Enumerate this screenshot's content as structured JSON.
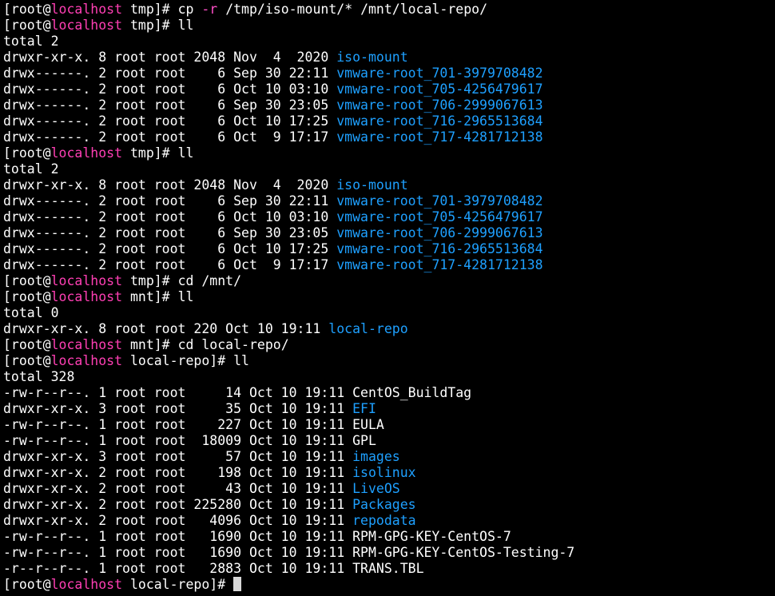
{
  "colors": {
    "background": "#000000",
    "text": "#ffffff",
    "hostname": "#ff3fb4",
    "directory": "#1ea0ff",
    "cursor": "#d8d8d8"
  },
  "terminal": {
    "lines": [
      {
        "kind": "prompt",
        "user": "root",
        "host": "localhost",
        "cwd": "tmp",
        "cmd": "cp -r /tmp/iso-mount/* /mnt/local-repo/"
      },
      {
        "kind": "prompt",
        "user": "root",
        "host": "localhost",
        "cwd": "tmp",
        "cmd": "ll"
      },
      {
        "kind": "text",
        "text": "total 2"
      },
      {
        "kind": "entry",
        "meta": "drwxr-xr-x. 8 root root 2048 Nov  4  2020 ",
        "name": "iso-mount",
        "dir": true
      },
      {
        "kind": "entry",
        "meta": "drwx------. 2 root root    6 Sep 30 22:11 ",
        "name": "vmware-root_701-3979708482",
        "dir": true
      },
      {
        "kind": "entry",
        "meta": "drwx------. 2 root root    6 Oct 10 03:10 ",
        "name": "vmware-root_705-4256479617",
        "dir": true
      },
      {
        "kind": "entry",
        "meta": "drwx------. 2 root root    6 Sep 30 23:05 ",
        "name": "vmware-root_706-2999067613",
        "dir": true
      },
      {
        "kind": "entry",
        "meta": "drwx------. 2 root root    6 Oct 10 17:25 ",
        "name": "vmware-root_716-2965513684",
        "dir": true
      },
      {
        "kind": "entry",
        "meta": "drwx------. 2 root root    6 Oct  9 17:17 ",
        "name": "vmware-root_717-4281712138",
        "dir": true
      },
      {
        "kind": "prompt",
        "user": "root",
        "host": "localhost",
        "cwd": "tmp",
        "cmd": "ll"
      },
      {
        "kind": "text",
        "text": "total 2"
      },
      {
        "kind": "entry",
        "meta": "drwxr-xr-x. 8 root root 2048 Nov  4  2020 ",
        "name": "iso-mount",
        "dir": true
      },
      {
        "kind": "entry",
        "meta": "drwx------. 2 root root    6 Sep 30 22:11 ",
        "name": "vmware-root_701-3979708482",
        "dir": true
      },
      {
        "kind": "entry",
        "meta": "drwx------. 2 root root    6 Oct 10 03:10 ",
        "name": "vmware-root_705-4256479617",
        "dir": true
      },
      {
        "kind": "entry",
        "meta": "drwx------. 2 root root    6 Sep 30 23:05 ",
        "name": "vmware-root_706-2999067613",
        "dir": true
      },
      {
        "kind": "entry",
        "meta": "drwx------. 2 root root    6 Oct 10 17:25 ",
        "name": "vmware-root_716-2965513684",
        "dir": true
      },
      {
        "kind": "entry",
        "meta": "drwx------. 2 root root    6 Oct  9 17:17 ",
        "name": "vmware-root_717-4281712138",
        "dir": true
      },
      {
        "kind": "prompt",
        "user": "root",
        "host": "localhost",
        "cwd": "tmp",
        "cmd": "cd /mnt/"
      },
      {
        "kind": "prompt",
        "user": "root",
        "host": "localhost",
        "cwd": "mnt",
        "cmd": "ll"
      },
      {
        "kind": "text",
        "text": "total 0"
      },
      {
        "kind": "entry",
        "meta": "drwxr-xr-x. 8 root root 220 Oct 10 19:11 ",
        "name": "local-repo",
        "dir": true
      },
      {
        "kind": "prompt",
        "user": "root",
        "host": "localhost",
        "cwd": "mnt",
        "cmd": "cd local-repo/"
      },
      {
        "kind": "prompt",
        "user": "root",
        "host": "localhost",
        "cwd": "local-repo",
        "cmd": "ll"
      },
      {
        "kind": "text",
        "text": "total 328"
      },
      {
        "kind": "entry",
        "meta": "-rw-r--r--. 1 root root     14 Oct 10 19:11 ",
        "name": "CentOS_BuildTag",
        "dir": false
      },
      {
        "kind": "entry",
        "meta": "drwxr-xr-x. 3 root root     35 Oct 10 19:11 ",
        "name": "EFI",
        "dir": true
      },
      {
        "kind": "entry",
        "meta": "-rw-r--r--. 1 root root    227 Oct 10 19:11 ",
        "name": "EULA",
        "dir": false
      },
      {
        "kind": "entry",
        "meta": "-rw-r--r--. 1 root root  18009 Oct 10 19:11 ",
        "name": "GPL",
        "dir": false
      },
      {
        "kind": "entry",
        "meta": "drwxr-xr-x. 3 root root     57 Oct 10 19:11 ",
        "name": "images",
        "dir": true
      },
      {
        "kind": "entry",
        "meta": "drwxr-xr-x. 2 root root    198 Oct 10 19:11 ",
        "name": "isolinux",
        "dir": true
      },
      {
        "kind": "entry",
        "meta": "drwxr-xr-x. 2 root root     43 Oct 10 19:11 ",
        "name": "LiveOS",
        "dir": true
      },
      {
        "kind": "entry",
        "meta": "drwxr-xr-x. 2 root root 225280 Oct 10 19:11 ",
        "name": "Packages",
        "dir": true
      },
      {
        "kind": "entry",
        "meta": "drwxr-xr-x. 2 root root   4096 Oct 10 19:11 ",
        "name": "repodata",
        "dir": true
      },
      {
        "kind": "entry",
        "meta": "-rw-r--r--. 1 root root   1690 Oct 10 19:11 ",
        "name": "RPM-GPG-KEY-CentOS-7",
        "dir": false
      },
      {
        "kind": "entry",
        "meta": "-rw-r--r--. 1 root root   1690 Oct 10 19:11 ",
        "name": "RPM-GPG-KEY-CentOS-Testing-7",
        "dir": false
      },
      {
        "kind": "entry",
        "meta": "-r--r--r--. 1 root root   2883 Oct 10 19:11 ",
        "name": "TRANS.TBL",
        "dir": false
      },
      {
        "kind": "prompt",
        "user": "root",
        "host": "localhost",
        "cwd": "local-repo",
        "cmd": "",
        "cursor": true
      }
    ]
  }
}
